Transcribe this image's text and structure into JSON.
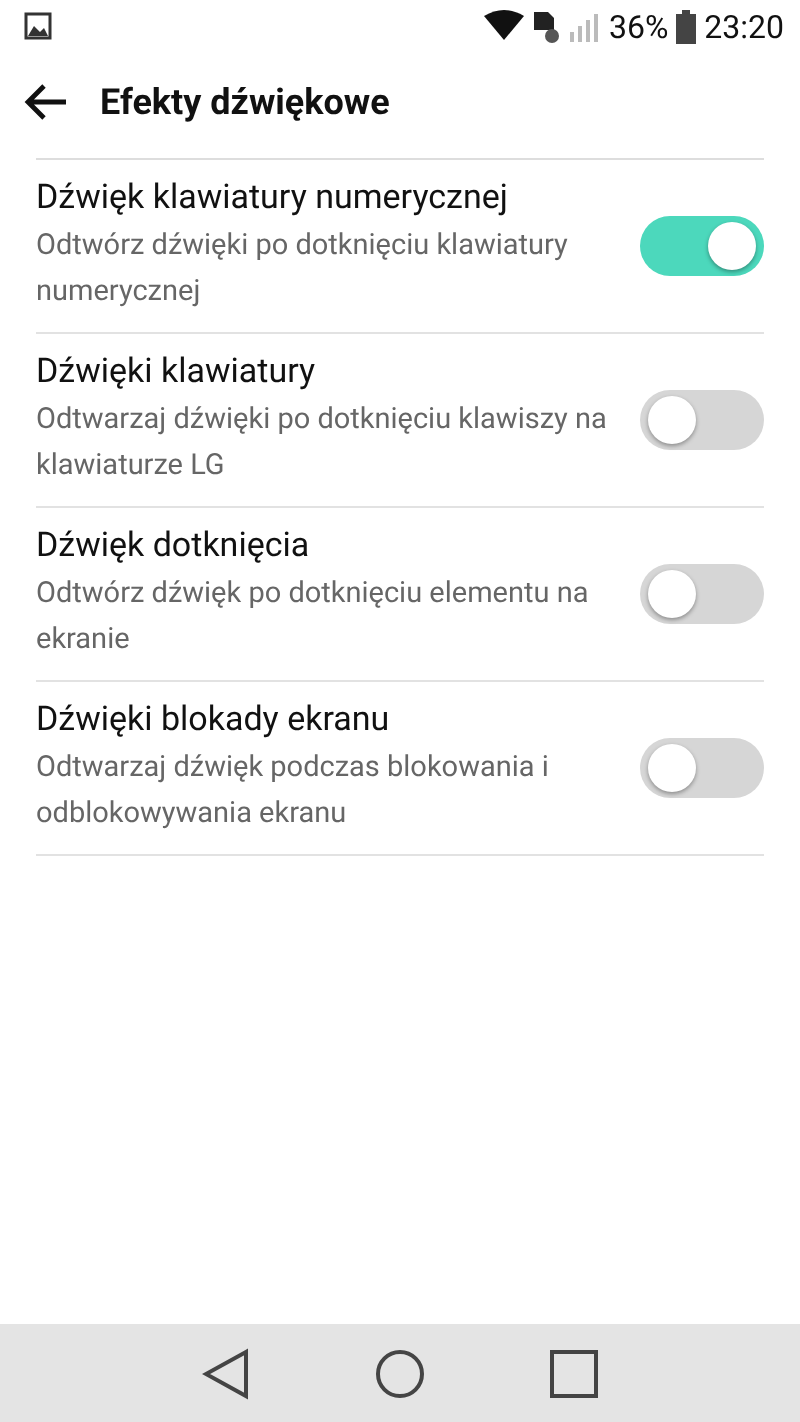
{
  "status_bar": {
    "battery": "36%",
    "time": "23:20"
  },
  "header": {
    "title": "Efekty dźwiękowe"
  },
  "settings": [
    {
      "title": "Dźwięk klawiatury numerycznej",
      "description": "Odtwórz dźwięki po dotknięciu klawiatury numerycznej",
      "on": true
    },
    {
      "title": "Dźwięki klawiatury",
      "description": "Odtwarzaj dźwięki po dotknięciu klawiszy na klawiaturze LG",
      "on": false
    },
    {
      "title": "Dźwięk dotknięcia",
      "description": "Odtwórz dźwięk po dotknięciu elementu na ekranie",
      "on": false
    },
    {
      "title": "Dźwięki blokady ekranu",
      "description": "Odtwarzaj dźwięk podczas blokowania i odblokowywania ekranu",
      "on": false
    }
  ]
}
